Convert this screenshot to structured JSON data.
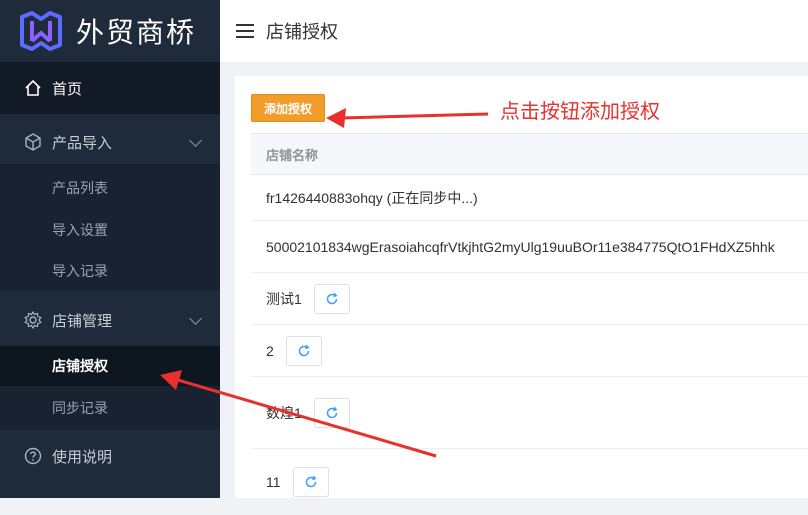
{
  "brand": {
    "name": "外贸商桥"
  },
  "header": {
    "title": "店铺授权"
  },
  "sidebar": {
    "home": "首页",
    "product_import": {
      "label": "产品导入",
      "items": [
        "产品列表",
        "导入设置",
        "导入记录"
      ]
    },
    "store_manage": {
      "label": "店铺管理",
      "items": [
        "店铺授权",
        "同步记录"
      ]
    },
    "help": "使用说明"
  },
  "toolbar": {
    "add_label": "添加授权"
  },
  "table": {
    "header": "店铺名称",
    "rows": [
      "fr1426440883ohqy (正在同步中...)",
      "50002101834wgErasoiahcqfrVtkjhtG2myUlg19uuBOr11e384775QtO1FHdXZ5hhk",
      "测试1",
      "2",
      "数煌1",
      "11"
    ]
  },
  "annotation": {
    "text": "点击按钮添加授权"
  },
  "colors": {
    "sidebar": "#1f2a3a",
    "accent": "#f29c2b",
    "annotation": "#e8312c"
  }
}
